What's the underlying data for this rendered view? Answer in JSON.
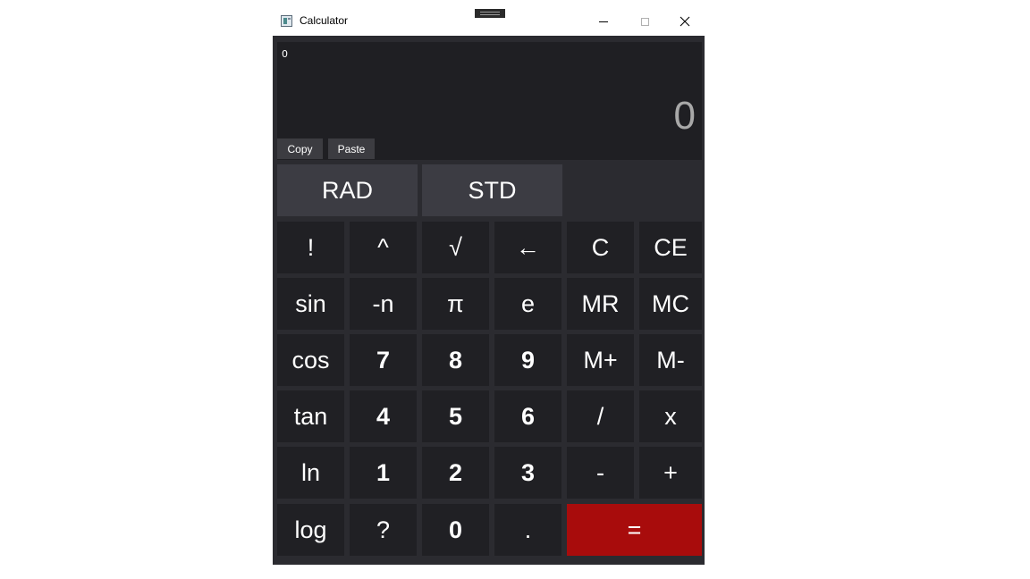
{
  "window": {
    "title": "Calculator"
  },
  "display": {
    "expression": "0",
    "result": "0"
  },
  "actions": {
    "copy_label": "Copy",
    "paste_label": "Paste"
  },
  "modes": {
    "angle_label": "RAD",
    "format_label": "STD"
  },
  "keys": [
    [
      {
        "label": "!",
        "name": "factorial-key"
      },
      {
        "label": "^",
        "name": "power-key"
      },
      {
        "label": "√",
        "name": "sqrt-key"
      },
      {
        "label": "←",
        "name": "backspace-key"
      },
      {
        "label": "C",
        "name": "clear-key"
      },
      {
        "label": "CE",
        "name": "clear-entry-key"
      }
    ],
    [
      {
        "label": "sin",
        "name": "sin-key"
      },
      {
        "label": "-n",
        "name": "negate-key"
      },
      {
        "label": "π",
        "name": "pi-key"
      },
      {
        "label": "e",
        "name": "e-key"
      },
      {
        "label": "MR",
        "name": "memory-recall-key"
      },
      {
        "label": "MC",
        "name": "memory-clear-key"
      }
    ],
    [
      {
        "label": "cos",
        "name": "cos-key"
      },
      {
        "label": "7",
        "name": "digit-7-key"
      },
      {
        "label": "8",
        "name": "digit-8-key"
      },
      {
        "label": "9",
        "name": "digit-9-key"
      },
      {
        "label": "M+",
        "name": "memory-add-key"
      },
      {
        "label": "M-",
        "name": "memory-subtract-key"
      }
    ],
    [
      {
        "label": "tan",
        "name": "tan-key"
      },
      {
        "label": "4",
        "name": "digit-4-key"
      },
      {
        "label": "5",
        "name": "digit-5-key"
      },
      {
        "label": "6",
        "name": "digit-6-key"
      },
      {
        "label": "/",
        "name": "divide-key"
      },
      {
        "label": "x",
        "name": "multiply-key"
      }
    ],
    [
      {
        "label": "ln",
        "name": "ln-key"
      },
      {
        "label": "1",
        "name": "digit-1-key"
      },
      {
        "label": "2",
        "name": "digit-2-key"
      },
      {
        "label": "3",
        "name": "digit-3-key"
      },
      {
        "label": "-",
        "name": "subtract-key"
      },
      {
        "label": "+",
        "name": "add-key"
      }
    ],
    [
      {
        "label": "log",
        "name": "log-key"
      },
      {
        "label": "?",
        "name": "help-key"
      },
      {
        "label": "0",
        "name": "digit-0-key"
      },
      {
        "label": ".",
        "name": "decimal-key"
      },
      {
        "label": "=",
        "name": "equals-key"
      }
    ]
  ],
  "colors": {
    "equals_accent": "#a80c0c",
    "key_bg": "#202024",
    "window_bg": "#2b2b30"
  }
}
